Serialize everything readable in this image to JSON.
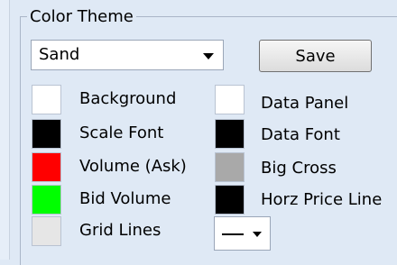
{
  "color_theme": {
    "legend": "Color Theme",
    "theme_select": {
      "value": "Sand"
    },
    "save_label": "Save"
  },
  "swatches": {
    "background": {
      "label": "Background",
      "color": "#ffffff"
    },
    "scale_font": {
      "label": "Scale Font",
      "color": "#000000"
    },
    "volume_ask": {
      "label": "Volume (Ask)",
      "color": "#ff0000"
    },
    "bid_volume": {
      "label": "Bid Volume",
      "color": "#00ff00"
    },
    "grid_lines": {
      "label": "Grid Lines",
      "color": "#e6e6e6"
    },
    "data_panel": {
      "label": "Data Panel",
      "color": "#ffffff"
    },
    "data_font": {
      "label": "Data Font",
      "color": "#000000"
    },
    "big_cross": {
      "label": "Big Cross",
      "color": "#a9a9a9"
    },
    "horz_price_line": {
      "label": "Horz Price Line",
      "color": "#000000"
    }
  },
  "line_style_select": {
    "value": "solid"
  }
}
